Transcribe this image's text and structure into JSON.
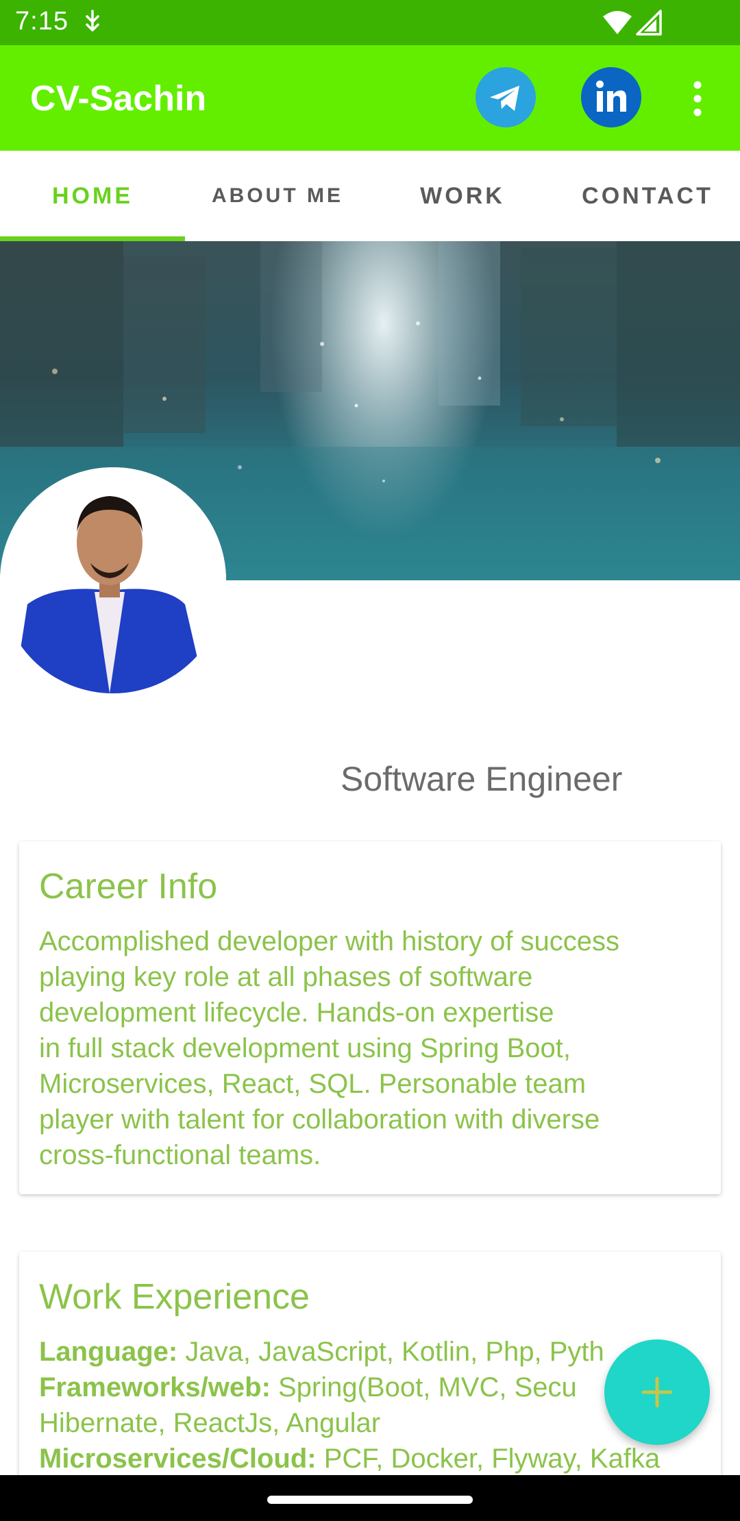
{
  "status_bar": {
    "time": "7:15"
  },
  "app_bar": {
    "title": "CV-Sachin",
    "actions": [
      {
        "icon": "telegram-icon",
        "color": "#2aa3de"
      },
      {
        "icon": "linkedin-icon",
        "color": "#0a66c2"
      },
      {
        "icon": "more-vert-icon"
      }
    ]
  },
  "tabs": [
    {
      "label": "HOME",
      "selected": true
    },
    {
      "label": "ABOUT ME",
      "selected": false
    },
    {
      "label": "WORK",
      "selected": false
    },
    {
      "label": "CONTACT",
      "selected": false
    }
  ],
  "profile": {
    "role": "Software Engineer"
  },
  "career_card": {
    "title": "Career Info",
    "body_lines": [
      "Accomplished developer with history of success",
      "playing key role at all phases of software",
      "development lifecycle. Hands-on expertise",
      "in full stack development using Spring Boot,",
      "Microservices, React, SQL. Personable team",
      "player with talent for collaboration with diverse",
      "cross-functional teams."
    ]
  },
  "work_card": {
    "title": "Work Experience",
    "lines": [
      {
        "label": "Language:",
        "text": " Java, JavaScript, Kotlin, Php, Pyth"
      },
      {
        "label": "Frameworks/web:",
        "text": " Spring(Boot, MVC, Secu"
      },
      {
        "label": "",
        "text": "Hibernate, ReactJs, Angular"
      },
      {
        "label": "Microservices/Cloud:",
        "text": " PCF, Docker, Flyway, Kafka"
      }
    ]
  },
  "fab": {
    "icon": "add-icon"
  },
  "colors": {
    "status_bar": "#3cb300",
    "app_bar": "#63ee00",
    "accent": "#6ad11e",
    "card_text": "#8bc34a",
    "fab": "#1fd6c8"
  }
}
